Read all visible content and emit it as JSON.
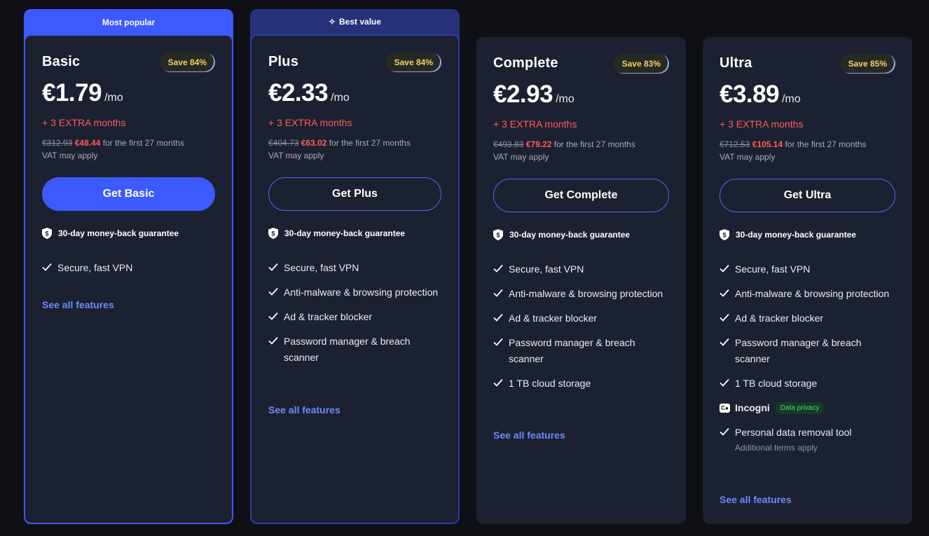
{
  "plans": [
    {
      "banner": "Most popular",
      "name": "Basic",
      "save": "Save 84%",
      "price": "€1.79",
      "per": "/mo",
      "extra": "+ 3 EXTRA months",
      "old_price": "€312.93",
      "new_price": "€48.44",
      "period_text": "for the first 27 months",
      "vat": "VAT may apply",
      "button": "Get Basic",
      "guarantee": "30-day money-back guarantee",
      "features": [
        "Secure, fast VPN"
      ],
      "see_all": "See all features"
    },
    {
      "banner": "Best value",
      "name": "Plus",
      "save": "Save 84%",
      "price": "€2.33",
      "per": "/mo",
      "extra": "+ 3 EXTRA months",
      "old_price": "€404.73",
      "new_price": "€63.02",
      "period_text": "for the first 27 months",
      "vat": "VAT may apply",
      "button": "Get Plus",
      "guarantee": "30-day money-back guarantee",
      "features": [
        "Secure, fast VPN",
        "Anti-malware & browsing protection",
        "Ad & tracker blocker",
        "Password manager & breach scanner"
      ],
      "see_all": "See all features"
    },
    {
      "name": "Complete",
      "save": "Save 83%",
      "price": "€2.93",
      "per": "/mo",
      "extra": "+ 3 EXTRA months",
      "old_price": "€493.83",
      "new_price": "€79.22",
      "period_text": "for the first 27 months",
      "vat": "VAT may apply",
      "button": "Get Complete",
      "guarantee": "30-day money-back guarantee",
      "features": [
        "Secure, fast VPN",
        "Anti-malware & browsing protection",
        "Ad & tracker blocker",
        "Password manager & breach scanner",
        "1 TB cloud storage"
      ],
      "see_all": "See all features"
    },
    {
      "name": "Ultra",
      "save": "Save 85%",
      "price": "€3.89",
      "per": "/mo",
      "extra": "+ 3 EXTRA months",
      "old_price": "€712.53",
      "new_price": "€105.14",
      "period_text": "for the first 27 months",
      "vat": "VAT may apply",
      "button": "Get Ultra",
      "guarantee": "30-day money-back guarantee",
      "features": [
        "Secure, fast VPN",
        "Anti-malware & browsing protection",
        "Ad & tracker blocker",
        "Password manager & breach scanner",
        "1 TB cloud storage"
      ],
      "incogni_label": "Incogni",
      "incogni_logo_text": "C●",
      "incogni_badge": "Data privacy",
      "extra_feature": "Personal data removal tool",
      "extra_feature_note": "Additional terms apply",
      "see_all": "See all features"
    }
  ],
  "colors": {
    "accent": "#3d5afe",
    "background": "#0e1016",
    "card": "#1c2131",
    "promo_red": "#ff5c5c",
    "save_gold": "#f5d06a",
    "link": "#6d8bff"
  }
}
